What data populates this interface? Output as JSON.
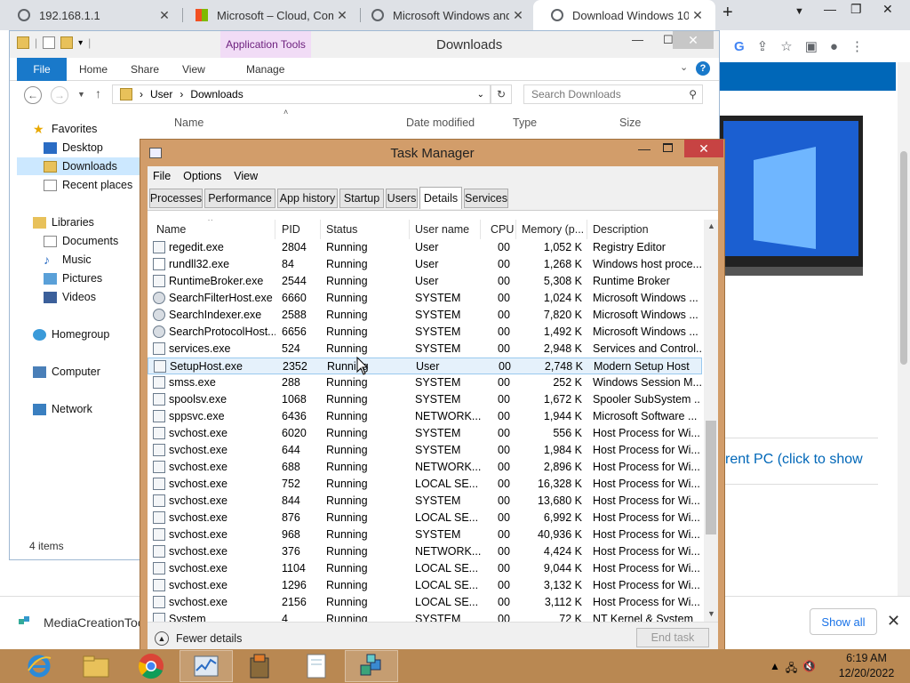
{
  "browser": {
    "tabs": [
      {
        "title": "192.168.1.1"
      },
      {
        "title": "Microsoft – Cloud, Comp"
      },
      {
        "title": "Microsoft Windows and /"
      },
      {
        "title": "Download Windows 10"
      }
    ],
    "new_tab": "+",
    "page_text": "rent PC (click to show",
    "download": {
      "name": "MediaCreationToo",
      "show_all": "Show all"
    }
  },
  "explorer": {
    "app_tools": "Application Tools",
    "title": "Downloads",
    "ribbon": {
      "file": "File",
      "home": "Home",
      "share": "Share",
      "view": "View",
      "manage": "Manage"
    },
    "path": [
      "User",
      "Downloads"
    ],
    "search_placeholder": "Search Downloads",
    "columns": {
      "name": "Name",
      "date": "Date modified",
      "type": "Type",
      "size": "Size"
    },
    "nav": [
      {
        "label": "Favorites",
        "icon": "star-icon"
      },
      {
        "label": "Desktop",
        "icon": "desktop-icon"
      },
      {
        "label": "Downloads",
        "icon": "folder-icon"
      },
      {
        "label": "Recent places",
        "icon": "recent-icon"
      },
      {
        "label": "Libraries",
        "icon": "libraries-icon"
      },
      {
        "label": "Documents",
        "icon": "documents-icon"
      },
      {
        "label": "Music",
        "icon": "music-icon"
      },
      {
        "label": "Pictures",
        "icon": "pictures-icon"
      },
      {
        "label": "Videos",
        "icon": "videos-icon"
      },
      {
        "label": "Homegroup",
        "icon": "homegroup-icon"
      },
      {
        "label": "Computer",
        "icon": "computer-icon"
      },
      {
        "label": "Network",
        "icon": "network-icon"
      }
    ],
    "status": "4 items"
  },
  "taskmgr": {
    "title": "Task Manager",
    "menu": [
      "File",
      "Options",
      "View"
    ],
    "tabs": [
      "Processes",
      "Performance",
      "App history",
      "Startup",
      "Users",
      "Details",
      "Services"
    ],
    "active_tab": "Details",
    "columns": [
      "Name",
      "PID",
      "Status",
      "User name",
      "CPU",
      "Memory (p...",
      "Description"
    ],
    "rows": [
      [
        "regedit.exe",
        "2804",
        "Running",
        "User",
        "00",
        "1,052 K",
        "Registry Editor"
      ],
      [
        "rundll32.exe",
        "84",
        "Running",
        "User",
        "00",
        "1,268 K",
        "Windows host proce..."
      ],
      [
        "RuntimeBroker.exe",
        "2544",
        "Running",
        "User",
        "00",
        "5,308 K",
        "Runtime Broker"
      ],
      [
        "SearchFilterHost.exe",
        "6660",
        "Running",
        "SYSTEM",
        "00",
        "1,024 K",
        "Microsoft Windows ..."
      ],
      [
        "SearchIndexer.exe",
        "2588",
        "Running",
        "SYSTEM",
        "00",
        "7,820 K",
        "Microsoft Windows ..."
      ],
      [
        "SearchProtocolHost....",
        "6656",
        "Running",
        "SYSTEM",
        "00",
        "1,492 K",
        "Microsoft Windows ..."
      ],
      [
        "services.exe",
        "524",
        "Running",
        "SYSTEM",
        "00",
        "2,948 K",
        "Services and Control..."
      ],
      [
        "SetupHost.exe",
        "2352",
        "Running",
        "User",
        "00",
        "2,748 K",
        "Modern Setup Host"
      ],
      [
        "smss.exe",
        "288",
        "Running",
        "SYSTEM",
        "00",
        "252 K",
        "Windows Session M..."
      ],
      [
        "spoolsv.exe",
        "1068",
        "Running",
        "SYSTEM",
        "00",
        "1,672 K",
        "Spooler SubSystem ..."
      ],
      [
        "sppsvc.exe",
        "6436",
        "Running",
        "NETWORK...",
        "00",
        "1,944 K",
        "Microsoft Software ..."
      ],
      [
        "svchost.exe",
        "6020",
        "Running",
        "SYSTEM",
        "00",
        "556 K",
        "Host Process for Wi..."
      ],
      [
        "svchost.exe",
        "644",
        "Running",
        "SYSTEM",
        "00",
        "1,984 K",
        "Host Process for Wi..."
      ],
      [
        "svchost.exe",
        "688",
        "Running",
        "NETWORK...",
        "00",
        "2,896 K",
        "Host Process for Wi..."
      ],
      [
        "svchost.exe",
        "752",
        "Running",
        "LOCAL SE...",
        "00",
        "16,328 K",
        "Host Process for Wi..."
      ],
      [
        "svchost.exe",
        "844",
        "Running",
        "SYSTEM",
        "00",
        "13,680 K",
        "Host Process for Wi..."
      ],
      [
        "svchost.exe",
        "876",
        "Running",
        "LOCAL SE...",
        "00",
        "6,992 K",
        "Host Process for Wi..."
      ],
      [
        "svchost.exe",
        "968",
        "Running",
        "SYSTEM",
        "00",
        "40,936 K",
        "Host Process for Wi..."
      ],
      [
        "svchost.exe",
        "376",
        "Running",
        "NETWORK...",
        "00",
        "4,424 K",
        "Host Process for Wi..."
      ],
      [
        "svchost.exe",
        "1104",
        "Running",
        "LOCAL SE...",
        "00",
        "9,044 K",
        "Host Process for Wi..."
      ],
      [
        "svchost.exe",
        "1296",
        "Running",
        "LOCAL SE...",
        "00",
        "3,132 K",
        "Host Process for Wi..."
      ],
      [
        "svchost.exe",
        "2156",
        "Running",
        "LOCAL SE...",
        "00",
        "3,112 K",
        "Host Process for Wi..."
      ],
      [
        "System",
        "4",
        "Running",
        "SYSTEM",
        "00",
        "72 K",
        "NT Kernel & System"
      ]
    ],
    "selected_row": 7,
    "fewer_details": "Fewer details",
    "end_task": "End task"
  },
  "taskbar": {
    "time": "6:19 AM",
    "date": "12/20/2022",
    "apps": [
      "internet-explorer-icon",
      "file-explorer-icon",
      "chrome-icon",
      "task-manager-icon",
      "setup-icon",
      "notepad-icon",
      "setup-cubes-icon"
    ]
  },
  "colors": {
    "window_frame": "#d29d6a",
    "taskbar": "#b98852",
    "accent": "#1979ca",
    "selection": "#e5f1fb"
  }
}
